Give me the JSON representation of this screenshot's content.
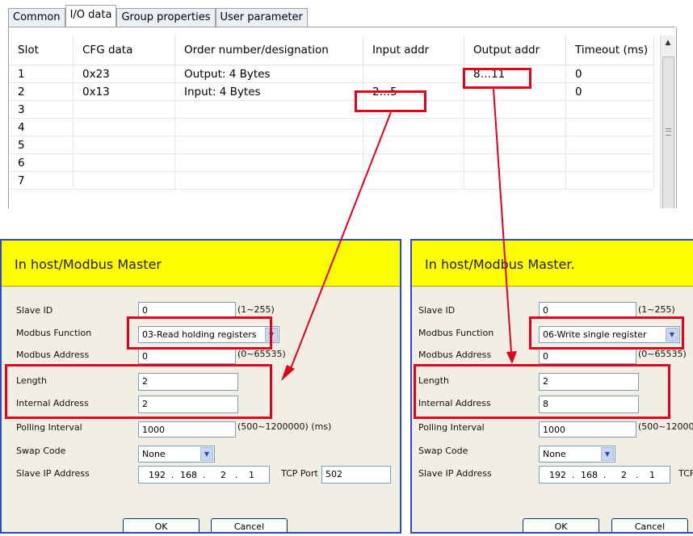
{
  "tabs": [
    "Common",
    "I/O data",
    "Group properties",
    "User parameter"
  ],
  "columns": [
    "Slot",
    "CFG data",
    "Order number/designation",
    "Input addr",
    "Output addr",
    "Timeout (ms)"
  ],
  "rows": [
    [
      "1",
      "0x23",
      "Output: 4 Bytes",
      "",
      "8…11",
      "0"
    ],
    [
      "2",
      "0x13",
      "Input: 4 Bytes",
      "2…5",
      "",
      "0"
    ],
    [
      "3",
      "",
      "",
      "",
      "",
      ""
    ],
    [
      "4",
      "",
      "",
      "",
      "",
      ""
    ],
    [
      "5",
      "",
      "",
      "",
      "",
      ""
    ],
    [
      "6",
      "",
      "",
      "",
      "",
      ""
    ],
    [
      "7",
      "",
      "",
      "",
      "",
      ""
    ]
  ],
  "dialogs": {
    "left": {
      "banner": "In host/Modbus Master",
      "labels": {
        "slave_id": "Slave ID",
        "modbus_function": "Modbus Function",
        "modbus_address": "Modbus Address",
        "length": "Length",
        "internal_address": "Internal Address",
        "polling_interval": "Polling Interval",
        "swap_code": "Swap Code",
        "slave_ip": "Slave IP Address",
        "tcp_port": "TCP Port"
      },
      "slave_id": "0",
      "slave_id_range": "(1~255)",
      "modbus_function": "03-Read holding registers",
      "modbus_address": "0",
      "modbus_address_range": "(0~65535)",
      "length": "2",
      "internal_address": "2",
      "polling_interval": "1000",
      "polling_range": "(500~1200000) (ms)",
      "swap_code": "None",
      "ip": [
        "192",
        "168",
        "2",
        "1"
      ],
      "tcp_port": "502",
      "ok": "OK",
      "cancel": "Cancel"
    },
    "right": {
      "banner": "In host/Modbus Master.",
      "labels": {
        "slave_id": "Slave ID",
        "modbus_function": "Modbus Function",
        "modbus_address": "Modbus Address",
        "length": "Length",
        "internal_address": "Internal Address",
        "polling_interval": "Polling Interval",
        "swap_code": "Swap Code",
        "slave_ip": "Slave IP Address",
        "tcp_port": "TCF"
      },
      "slave_id": "0",
      "slave_id_range": "(1~255)",
      "modbus_function": "06-Write single register",
      "modbus_address": "0",
      "modbus_address_range": "(0~65535)",
      "length": "2",
      "internal_address": "8",
      "polling_interval": "1000",
      "polling_range": "(500~12000",
      "swap_code": "None",
      "ip": [
        "192",
        "168",
        "2",
        "1"
      ],
      "ok": "OK",
      "cancel": "Cancel"
    }
  },
  "colors": {
    "highlight": "#e2001a",
    "banner": "#ffff00",
    "dialog_border": "#2a4cc4",
    "dialog_bg": "#f1efe4"
  }
}
